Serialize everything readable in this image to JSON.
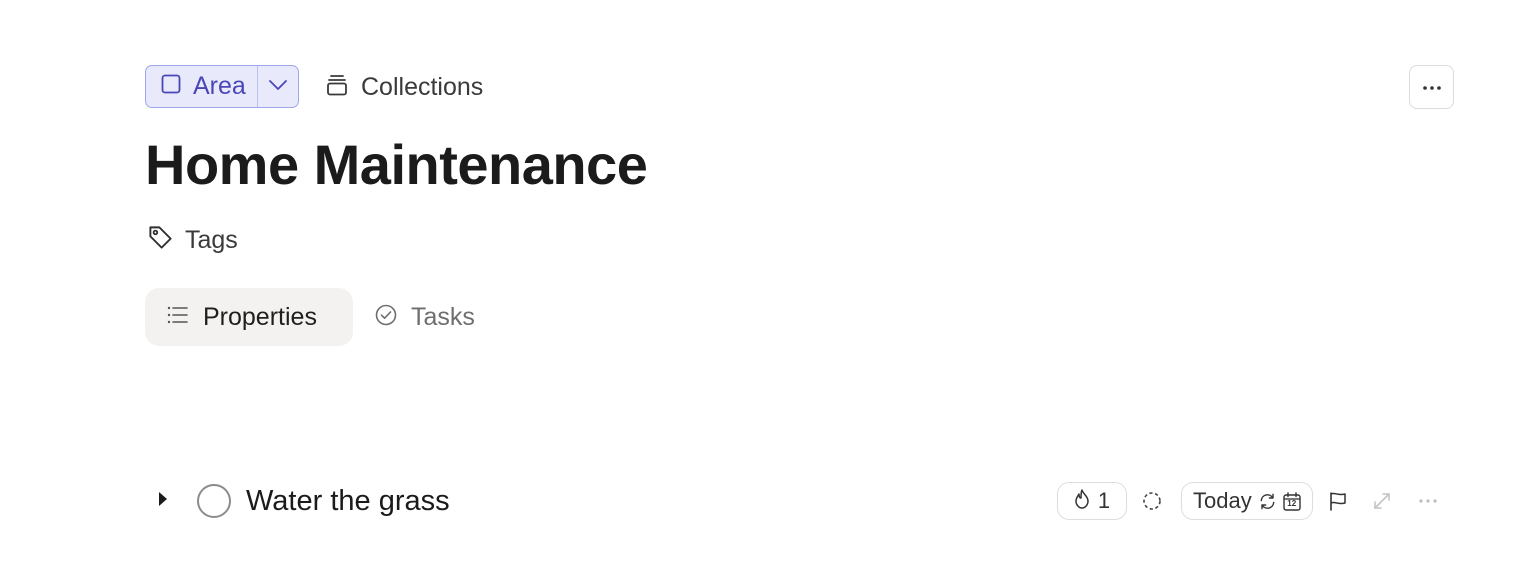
{
  "header": {
    "type_label": "Area",
    "collections_label": "Collections"
  },
  "page": {
    "title": "Home Maintenance",
    "tags_label": "Tags"
  },
  "tabs": [
    {
      "label": "Properties",
      "active": true
    },
    {
      "label": "Tasks",
      "active": false
    }
  ],
  "task": {
    "title": "Water the grass",
    "energy_value": "1",
    "date_label": "Today",
    "calendar_day": "12"
  },
  "colors": {
    "accent": "#4a46b8",
    "accent_bg": "#e8eafc",
    "accent_border": "#9ea6ec"
  }
}
